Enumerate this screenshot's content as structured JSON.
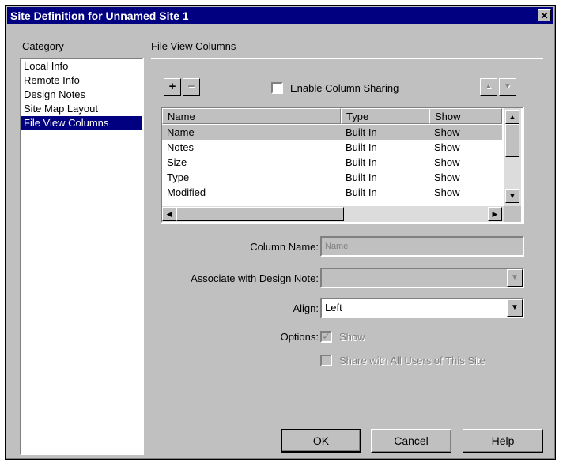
{
  "window": {
    "title": "Site Definition for Unnamed Site 1",
    "close_glyph": "✕"
  },
  "category": {
    "label": "Category",
    "items": [
      {
        "label": "Local Info"
      },
      {
        "label": "Remote Info"
      },
      {
        "label": "Design Notes"
      },
      {
        "label": "Site Map Layout"
      },
      {
        "label": "File View Columns",
        "selected": true
      }
    ]
  },
  "panel": {
    "title": "File View Columns",
    "add_icon": "+",
    "remove_icon": "−",
    "enable_sharing_label": "Enable Column Sharing",
    "enable_sharing_checked": false,
    "move_up_icon": "▲",
    "move_down_icon": "▼"
  },
  "columns_table": {
    "headers": [
      "Name",
      "Type",
      "Show"
    ],
    "rows": [
      {
        "name": "Name",
        "type": "Built In",
        "show": "Show"
      },
      {
        "name": "Notes",
        "type": "Built In",
        "show": "Show"
      },
      {
        "name": "Size",
        "type": "Built In",
        "show": "Show"
      },
      {
        "name": "Type",
        "type": "Built In",
        "show": "Show"
      },
      {
        "name": "Modified",
        "type": "Built In",
        "show": "Show"
      }
    ],
    "selected_row": 0
  },
  "form": {
    "column_name_label": "Column Name:",
    "column_name_value": "Name",
    "associate_label": "Associate with Design Note:",
    "associate_value": "",
    "align_label": "Align:",
    "align_value": "Left",
    "options_label": "Options:",
    "show_option_label": "Show",
    "show_option_checked": true,
    "share_option_label": "Share with All Users of This Site",
    "share_option_checked": false
  },
  "buttons": {
    "ok": "OK",
    "cancel": "Cancel",
    "help": "Help"
  }
}
